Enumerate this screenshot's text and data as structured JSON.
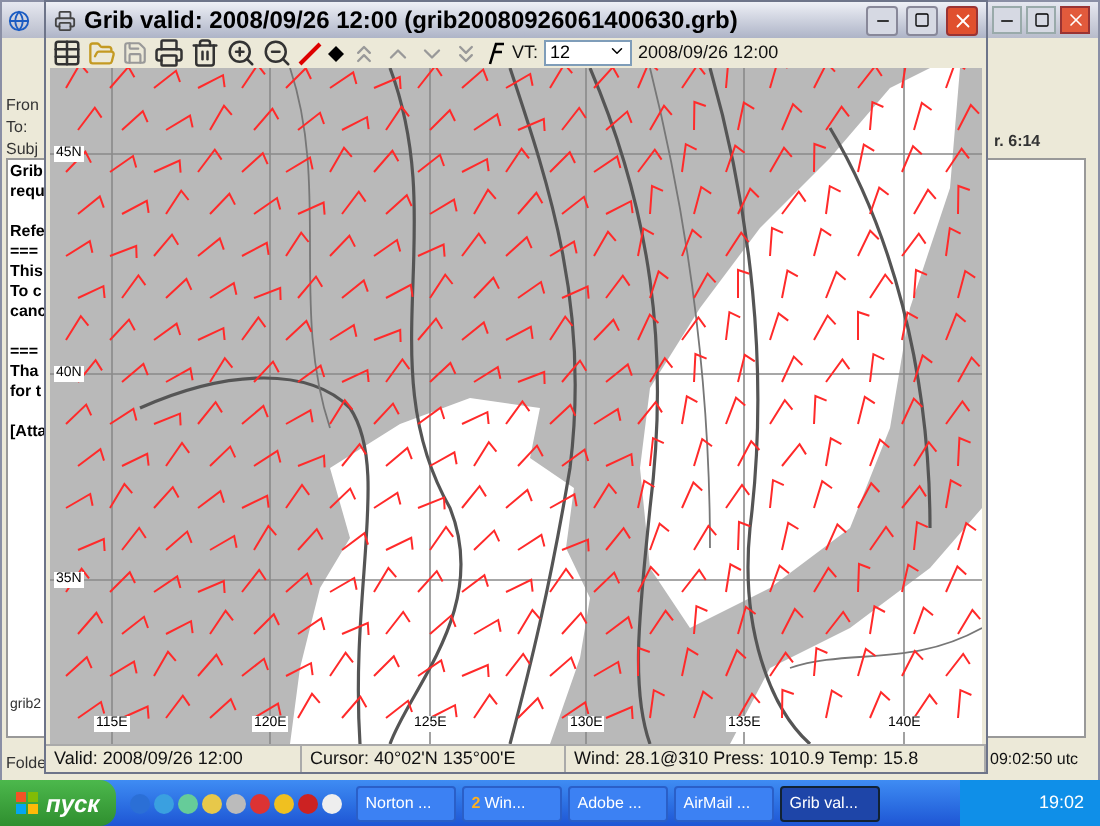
{
  "background_window": {
    "header_fields": [
      "Fron",
      "To:",
      "Subj"
    ],
    "body_paragraphs": [
      [
        "Grib",
        "requ"
      ],
      [
        "Refe",
        "===",
        "This",
        "To c",
        "canc"
      ],
      [
        "===",
        "Tha",
        "for t"
      ],
      [
        "[Atta"
      ]
    ],
    "footer_text": "grib2",
    "folder_label": "Folde",
    "right_text": "r. 6:14",
    "right_time": "09:02:50 utc"
  },
  "grib_window": {
    "title": "Grib valid: 2008/09/26 12:00 (grib20080926061400630.grb)",
    "toolbar": {
      "vt_label": "VT:",
      "vt_value": "12",
      "valid_time": "2008/09/26 12:00"
    },
    "map": {
      "lat_labels": [
        "45N",
        "40N",
        "35N"
      ],
      "lon_labels": [
        "115E",
        "120E",
        "125E",
        "130E",
        "135E",
        "140E"
      ]
    },
    "status_bar": [
      "Valid: 2008/09/26 12:00",
      "Cursor: 40°02'N  135°00'E",
      "Wind: 28.1@310  Press: 1010.9  Temp: 15.8"
    ]
  },
  "taskbar": {
    "start": "пуск",
    "tasks": [
      {
        "label": "Norton ...",
        "selected": false
      },
      {
        "count": "2",
        "label": "Win...",
        "selected": false
      },
      {
        "label": "Adobe ...",
        "selected": false
      },
      {
        "label": "AirMail ...",
        "selected": false
      },
      {
        "label": "Grib val...",
        "selected": true
      }
    ],
    "clock": "19:02"
  }
}
